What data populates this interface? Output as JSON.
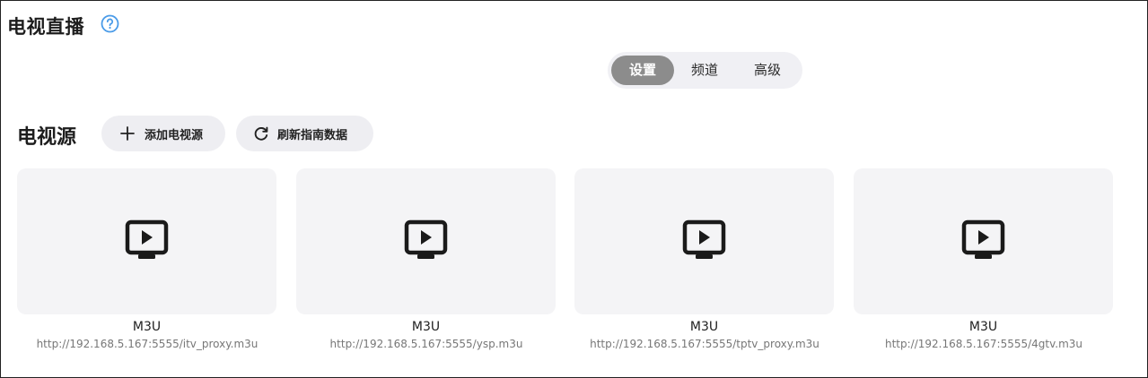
{
  "header": {
    "title": "电视直播",
    "help_icon": "help-circle-icon",
    "accent_color": "#4a9be8"
  },
  "tabs": [
    {
      "label": "设置",
      "active": true
    },
    {
      "label": "频道",
      "active": false
    },
    {
      "label": "高级",
      "active": false
    }
  ],
  "section": {
    "title": "电视源",
    "add_button": {
      "label": "添加电视源",
      "icon": "plus-icon"
    },
    "refresh_button": {
      "label": "刷新指南数据",
      "icon": "refresh-icon"
    }
  },
  "sources": [
    {
      "type": "M3U",
      "url": "http://192.168.5.167:5555/itv_proxy.m3u",
      "icon": "tv-play-icon"
    },
    {
      "type": "M3U",
      "url": "http://192.168.5.167:5555/ysp.m3u",
      "icon": "tv-play-icon"
    },
    {
      "type": "M3U",
      "url": "http://192.168.5.167:5555/tptv_proxy.m3u",
      "icon": "tv-play-icon"
    },
    {
      "type": "M3U",
      "url": "http://192.168.5.167:5555/4gtv.m3u",
      "icon": "tv-play-icon"
    }
  ]
}
